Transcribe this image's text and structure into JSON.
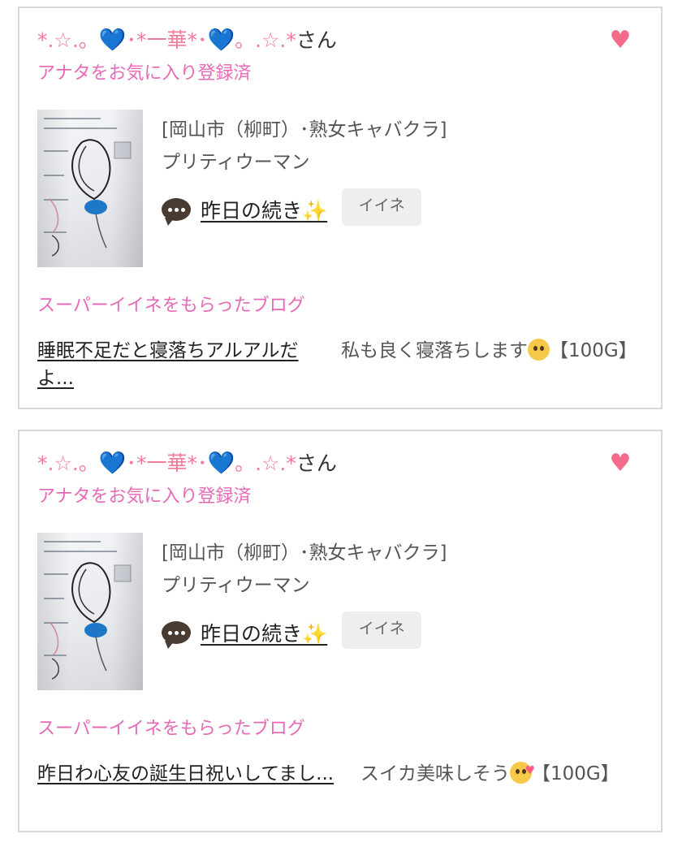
{
  "cards": [
    {
      "user": {
        "deco_left": "*.☆.。",
        "heart_left": "💙",
        "name_mid": "･*一華*･",
        "heart_right": "💙",
        "deco_right": "。.☆.*",
        "suffix": "さん"
      },
      "favorite_status": "アナタをお気に入り登録済",
      "favorite_icon": "heart-icon",
      "shop": {
        "area_genre": "[岡山市（柳町）･熟女キャバクラ]",
        "name": "プリティウーマン"
      },
      "post": {
        "icon": "speech-bubble-icon",
        "title": "昨日の続き",
        "title_emoji": "✨",
        "iine_label": "イイネ"
      },
      "super_iine_heading": "スーパーイイネをもらったブログ",
      "blog": {
        "link_text": "睡眠不足だと寝落ちアルアルだよ...",
        "comment_text": "私も良く寝落ちします",
        "comment_emoji": "pleading-face-emoji",
        "reward": "【100G】"
      }
    },
    {
      "user": {
        "deco_left": "*.☆.。",
        "heart_left": "💙",
        "name_mid": "･*一華*･",
        "heart_right": "💙",
        "deco_right": "。.☆.*",
        "suffix": "さん"
      },
      "favorite_status": "アナタをお気に入り登録済",
      "favorite_icon": "heart-icon",
      "shop": {
        "area_genre": "[岡山市（柳町）･熟女キャバクラ]",
        "name": "プリティウーマン"
      },
      "post": {
        "icon": "speech-bubble-icon",
        "title": "昨日の続き",
        "title_emoji": "✨",
        "iine_label": "イイネ"
      },
      "super_iine_heading": "スーパーイイネをもらったブログ",
      "blog": {
        "link_text": "昨日わ心友の誕生日祝いしてまし...",
        "comment_text": "スイカ美味しそう",
        "comment_emoji": "smiling-face-with-hearts-emoji",
        "reward": "【100G】"
      }
    }
  ],
  "colors": {
    "pink_label": "#e86ab7",
    "heart": "#f36b89",
    "deco": "#f07c9a",
    "border": "#d8d8d8"
  }
}
